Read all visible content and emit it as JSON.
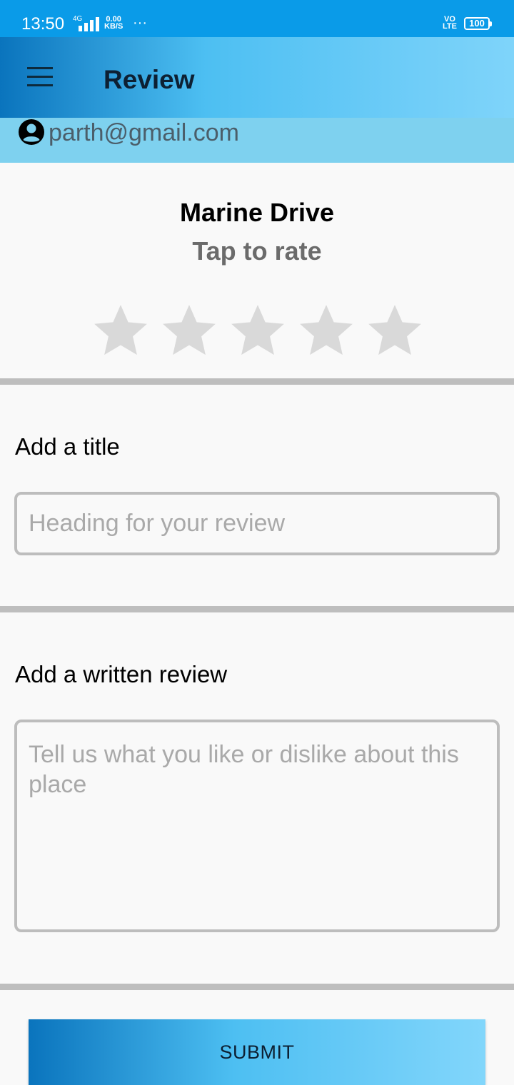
{
  "status_bar": {
    "time": "13:50",
    "network": "4G",
    "speed_value": "0.00",
    "speed_unit": "KB/S",
    "more": "···",
    "volte_top": "VO",
    "volte_bottom": "LTE",
    "battery": "100",
    "icons": [
      "signal-icon",
      "battery-icon"
    ]
  },
  "app_bar": {
    "title": "Review",
    "menu_icon": "menu-icon",
    "gradient": [
      "#0a74bd",
      "#4dbff2",
      "#7fd4fa"
    ]
  },
  "user": {
    "email": "parth@gmail.com",
    "icon": "account-circle-icon",
    "band_color": "#7ed1ef"
  },
  "rating": {
    "place_name": "Marine Drive",
    "prompt": "Tap to rate",
    "max_stars": 5,
    "selected": 0,
    "star_color": "#d9d9d9"
  },
  "title_section": {
    "label": "Add a title",
    "value": "",
    "placeholder": "Heading for your review"
  },
  "review_section": {
    "label": "Add a written review",
    "value": "",
    "placeholder": "Tell us what you like or dislike about this place"
  },
  "submit": {
    "label": "SUBMIT"
  }
}
